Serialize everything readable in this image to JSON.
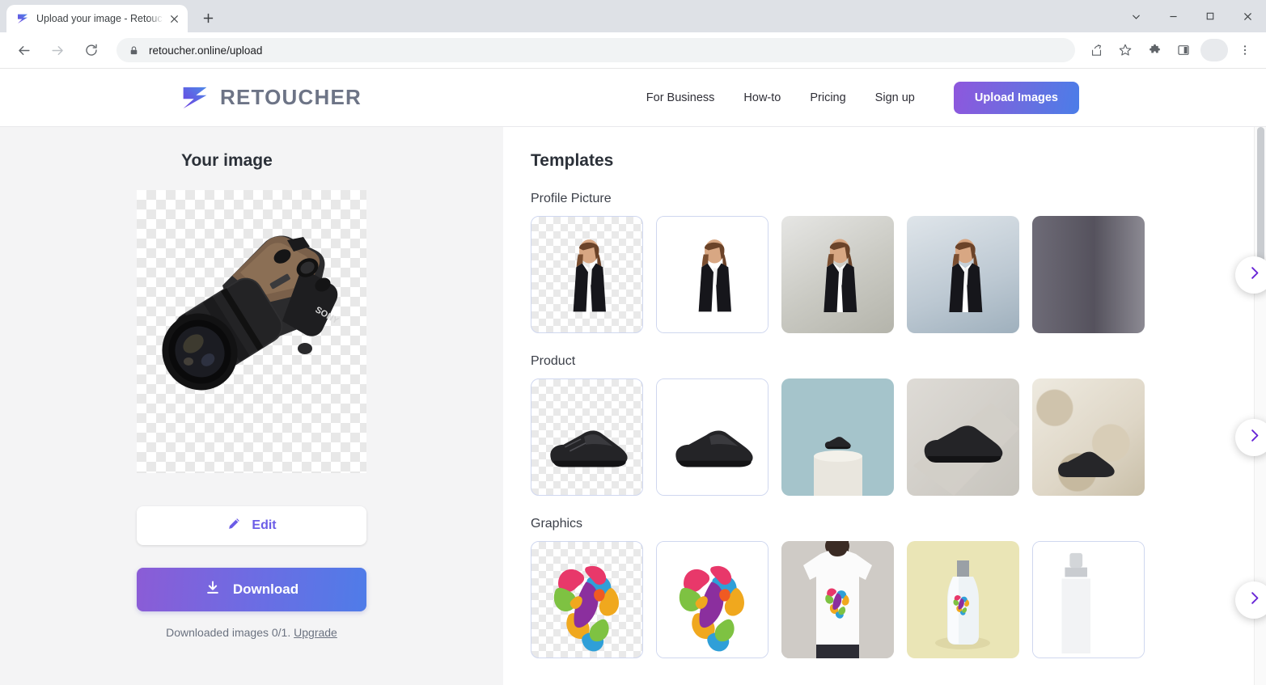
{
  "browser": {
    "tab": {
      "title": "Upload your image - Retoucher.O",
      "favicon_icon": "retoucher-logo-icon",
      "close_icon": "close-icon"
    },
    "new_tab_icon": "plus-icon",
    "window_controls": [
      {
        "name": "tab-search",
        "icon": "chevron-down-icon"
      },
      {
        "name": "minimize",
        "icon": "minimize-icon"
      },
      {
        "name": "maximize",
        "icon": "maximize-icon"
      },
      {
        "name": "close",
        "icon": "close-icon"
      }
    ],
    "back_icon": "back-arrow-icon",
    "forward_icon": "forward-arrow-icon",
    "reload_icon": "reload-icon",
    "omnibox": {
      "lock_icon": "lock-icon",
      "url": "retoucher.online/upload"
    },
    "toolbar_icons": [
      {
        "name": "share-icon"
      },
      {
        "name": "bookmark-star-icon"
      },
      {
        "name": "extensions-puzzle-icon"
      },
      {
        "name": "side-panel-icon"
      },
      {
        "name": "profile-avatar"
      },
      {
        "name": "chrome-menu-icon"
      }
    ]
  },
  "site": {
    "logo": {
      "text": "RETOUCHER",
      "icon": "retoucher-logo-icon"
    },
    "nav": [
      {
        "label": "For Business"
      },
      {
        "label": "How-to"
      },
      {
        "label": "Pricing"
      },
      {
        "label": "Sign up"
      }
    ],
    "cta": {
      "label": "Upload Images"
    },
    "accent_purple": "#6b5ce7",
    "gradient_from": "#8b5cd6",
    "gradient_to": "#4f7ce8"
  },
  "left_panel": {
    "title": "Your image",
    "preview_alt": "sony-camera-cutout",
    "edit_button": {
      "label": "Edit",
      "icon": "pencil-icon"
    },
    "download_button": {
      "label": "Download",
      "icon": "download-icon"
    },
    "download_note": {
      "text": "Downloaded images 0/1.",
      "link": "Upgrade"
    }
  },
  "templates": {
    "title": "Templates",
    "next_icon": "chevron-right-icon",
    "groups": [
      {
        "name": "Profile Picture",
        "items": [
          {
            "name": "transparent-background",
            "style": "checker"
          },
          {
            "name": "white-background",
            "style": "white"
          },
          {
            "name": "warm-gray-gradient-background",
            "style": "grad-warm"
          },
          {
            "name": "blue-gray-gradient-background",
            "style": "grad-blue"
          },
          {
            "name": "dark-gray-background",
            "style": "dark"
          }
        ]
      },
      {
        "name": "Product",
        "items": [
          {
            "name": "transparent-background",
            "style": "checker"
          },
          {
            "name": "white-background",
            "style": "white"
          },
          {
            "name": "teal-podium-background",
            "style": "teal-podium"
          },
          {
            "name": "gray-platform-background",
            "style": "gray-platform"
          },
          {
            "name": "marble-texture-background",
            "style": "marble"
          }
        ]
      },
      {
        "name": "Graphics",
        "items": [
          {
            "name": "transparent-background",
            "style": "checker"
          },
          {
            "name": "white-background",
            "style": "white"
          },
          {
            "name": "tshirt-mockup",
            "style": "tshirt"
          },
          {
            "name": "bottle-mockup",
            "style": "bottle"
          },
          {
            "name": "spray-bottle-mockup",
            "style": "spray"
          }
        ]
      }
    ]
  }
}
